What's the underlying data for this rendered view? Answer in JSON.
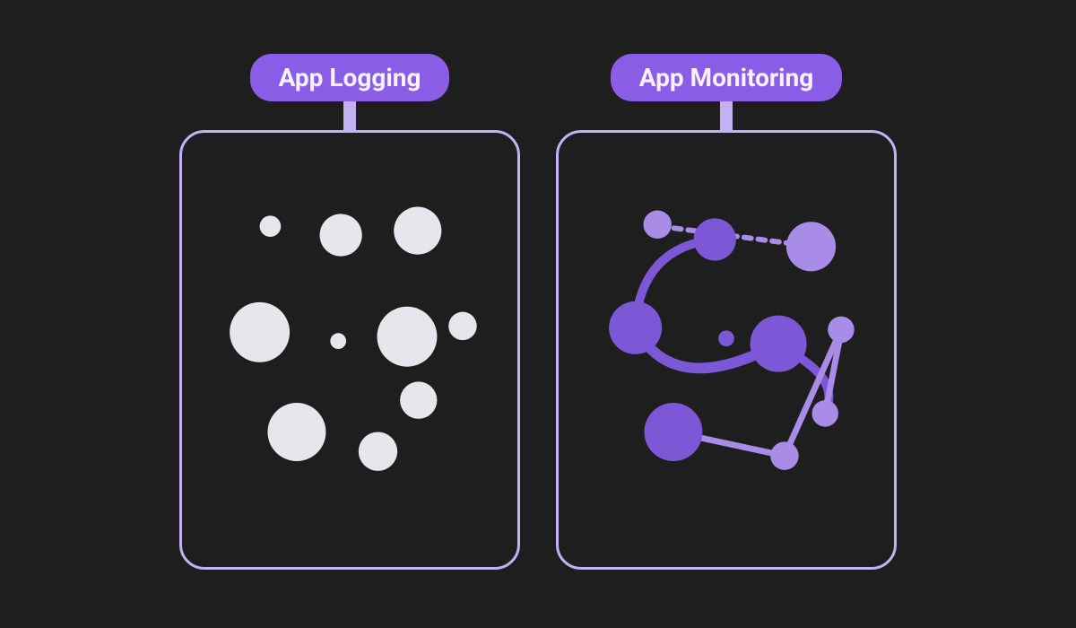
{
  "panels": {
    "logging": {
      "title": "App Logging"
    },
    "monitoring": {
      "title": "App Monitoring"
    }
  },
  "colors": {
    "background": "#1e1e1e",
    "pill": "#8a5de6",
    "border": "#c4b1f3",
    "dots_light": "#e8e6ed",
    "node_purple": "#7c57d6",
    "node_purple_light": "#a88ce8"
  }
}
